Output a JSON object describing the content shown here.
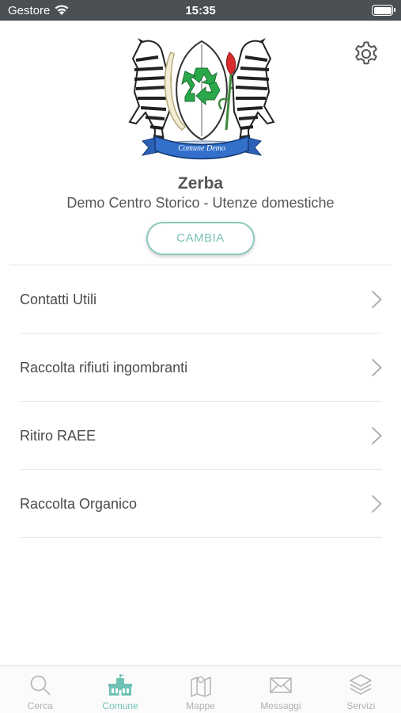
{
  "status_bar": {
    "carrier": "Gestore",
    "time": "15:35"
  },
  "crest": {
    "scroll_text": "Comune Demo"
  },
  "town": {
    "name": "Zerba",
    "subtitle": "Demo Centro Storico - Utenze domestiche"
  },
  "change_button": {
    "label": "CAMBIA"
  },
  "menu": {
    "items": [
      {
        "label": "Contatti Utili"
      },
      {
        "label": "Raccolta rifiuti ingombranti"
      },
      {
        "label": "Ritiro RAEE"
      },
      {
        "label": "Raccolta Organico"
      }
    ]
  },
  "tabbar": {
    "active": "Comune",
    "active_color": "#6fc2b3",
    "inactive_color": "#b0b0b0",
    "tabs": [
      {
        "label": "Cerca",
        "icon": "search-icon"
      },
      {
        "label": "Comune",
        "icon": "town-hall-icon"
      },
      {
        "label": "Mappe",
        "icon": "map-icon"
      },
      {
        "label": "Messaggi",
        "icon": "envelope-icon"
      },
      {
        "label": "Servizi",
        "icon": "layers-icon"
      }
    ]
  }
}
